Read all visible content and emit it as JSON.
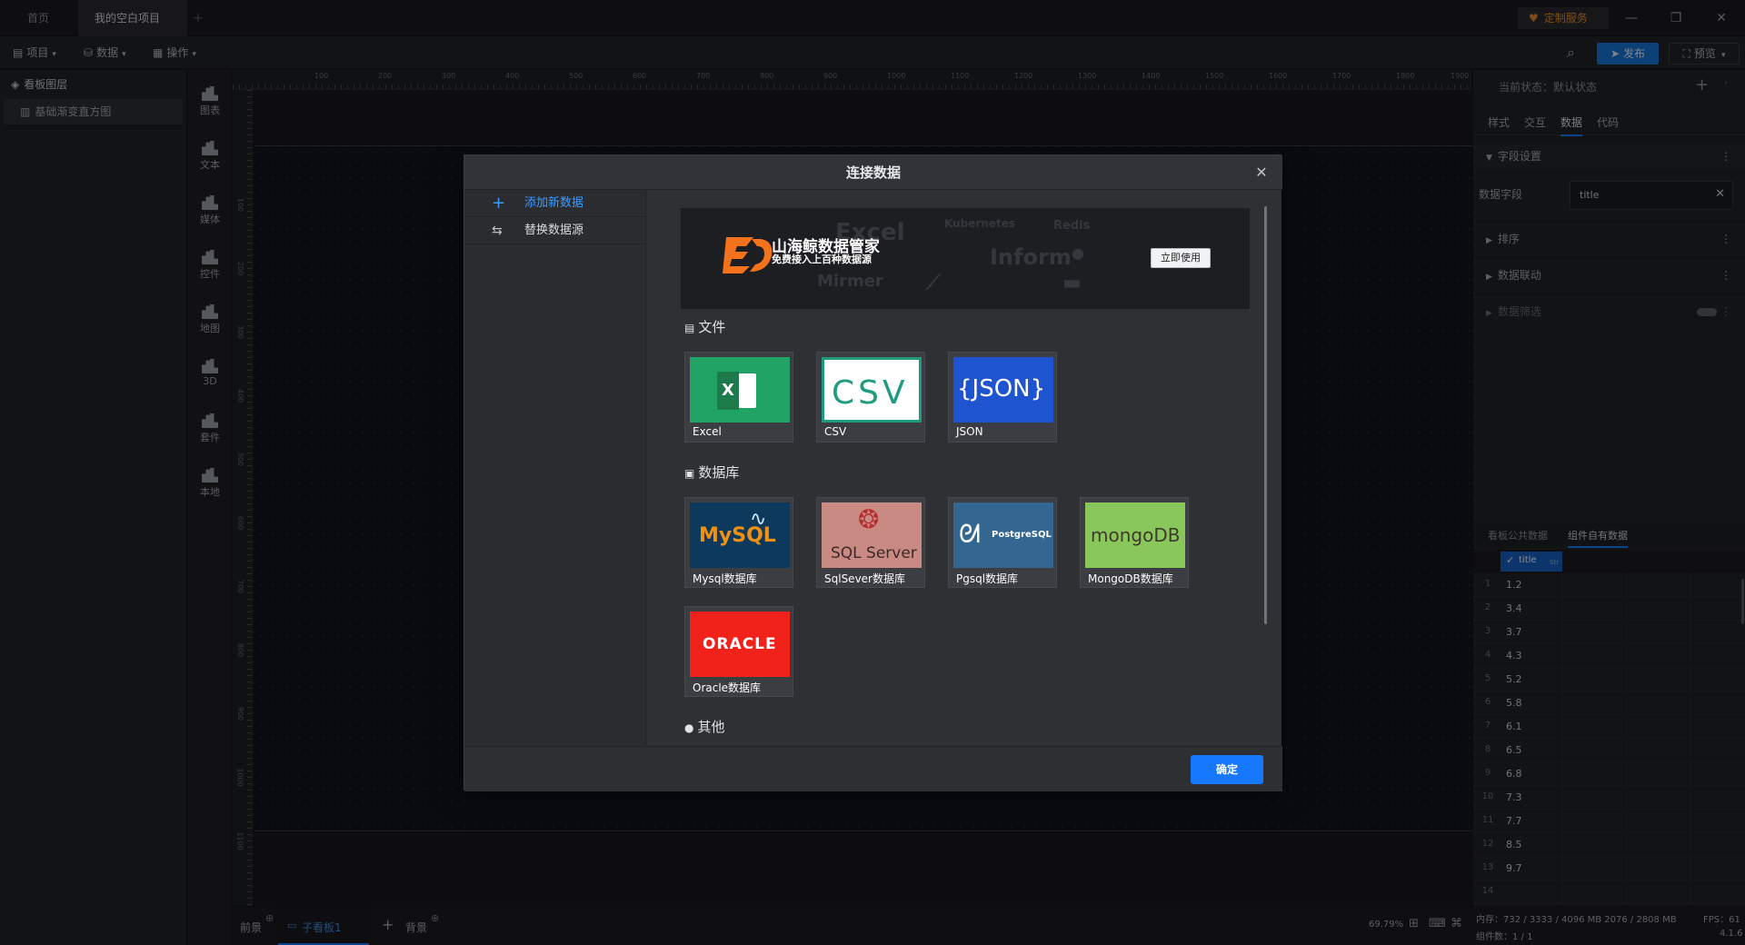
{
  "titlebar": {
    "tab_home": "首页",
    "tab_project": "我的空白项目",
    "custom_service": "定制服务"
  },
  "menubar": {
    "project": "项目",
    "data": "数据",
    "ops": "操作",
    "publish": "发布",
    "preview": "预览"
  },
  "layers": {
    "title": "看板图层",
    "item": "基础渐变直方图"
  },
  "components": [
    "图表",
    "文本",
    "媒体",
    "控件",
    "地图",
    "3D",
    "套件",
    "本地"
  ],
  "ruler": [
    "100",
    "200",
    "300",
    "400",
    "500",
    "600",
    "700",
    "800",
    "900",
    "1000",
    "1100",
    "1200",
    "1300",
    "1400",
    "1500",
    "1600",
    "1700",
    "1800",
    "1900"
  ],
  "ruler_left": [
    "100",
    "200",
    "300",
    "400",
    "500",
    "600",
    "700",
    "800",
    "900",
    "1000",
    "1100",
    "1200",
    "1300"
  ],
  "modal": {
    "title": "连接数据",
    "left_items": [
      "添加新数据",
      "替换数据源"
    ],
    "banner_title": "山海鲸数据管家",
    "banner_subtitle": "免费接入上百种数据源",
    "banner_button": "立即使用",
    "section_file": "文件",
    "section_db": "数据库",
    "section_other": "其他",
    "file_tiles": [
      {
        "label": "Excel",
        "logo": "X"
      },
      {
        "label": "CSV",
        "logo": "CSV"
      },
      {
        "label": "JSON",
        "logo": "{JSON}"
      }
    ],
    "db_tiles": [
      {
        "label": "Mysql数据库",
        "logo": "MySQL"
      },
      {
        "label": "SqlSever数据库",
        "logo": "SQL Server"
      },
      {
        "label": "Pgsql数据库",
        "logo": "PostgreSQL"
      },
      {
        "label": "MongoDB数据库",
        "logo": "mongoDB"
      },
      {
        "label": "Oracle数据库",
        "logo": "ORACLE"
      }
    ],
    "confirm": "确定"
  },
  "right_panel": {
    "state": "当前状态：默认状态",
    "tabs": [
      "样式",
      "交互",
      "数据",
      "代码"
    ],
    "field_settings": "字段设置",
    "data_field_label": "数据字段",
    "data_field_value": "title",
    "sort": "排序",
    "linkage": "数据联动",
    "filter": "数据筛选",
    "data_tabs": [
      "看板公共数据",
      "组件自有数据"
    ],
    "column": "title",
    "column_type": "Str",
    "rows": [
      {
        "n": "1",
        "v": "1.2"
      },
      {
        "n": "2",
        "v": "3.4"
      },
      {
        "n": "3",
        "v": "3.7"
      },
      {
        "n": "4",
        "v": "4.3"
      },
      {
        "n": "5",
        "v": "5.2"
      },
      {
        "n": "6",
        "v": "5.8"
      },
      {
        "n": "7",
        "v": "6.1"
      },
      {
        "n": "8",
        "v": "6.5"
      },
      {
        "n": "9",
        "v": "6.8"
      },
      {
        "n": "10",
        "v": "7.3"
      },
      {
        "n": "11",
        "v": "7.7"
      },
      {
        "n": "12",
        "v": "8.5"
      },
      {
        "n": "13",
        "v": "9.7"
      },
      {
        "n": "14",
        "v": ""
      }
    ]
  },
  "bottombar": {
    "foreground": "前景",
    "sub_board": "子看板1",
    "background": "背景",
    "zoom": "69.79%"
  },
  "status": {
    "memory": "内存：732 / 3333 / 4096 MB  2076 / 2808 MB",
    "fps": "FPS：61",
    "components": "组件数：1 / 1",
    "version": "4.1.6"
  }
}
